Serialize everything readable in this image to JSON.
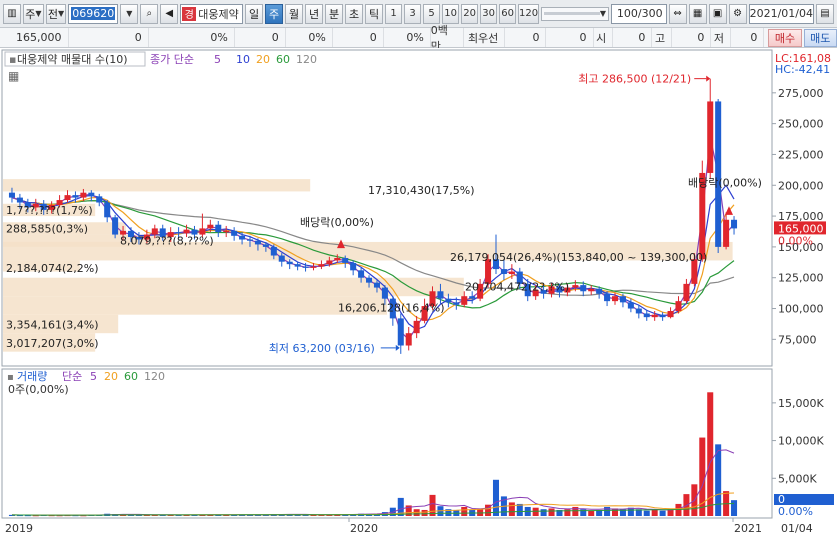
{
  "toolbar": {
    "type_label": "주",
    "prev_label": "전",
    "code": "069620",
    "name_badge": "경",
    "name": "대웅제약",
    "period_day": "일",
    "period_week": "주",
    "period_month": "월",
    "period_year": "년",
    "period_min": "분",
    "period_sec": "초",
    "period_tick": "틱",
    "intervals": [
      "1",
      "3",
      "5",
      "10",
      "20",
      "30",
      "60",
      "120"
    ],
    "bar_count": "100/300",
    "date": "2021/01/04"
  },
  "infobar": {
    "price": "165,000",
    "c2": "0",
    "c3": "0%",
    "c4": "0",
    "c5": "0%",
    "c6": "0",
    "c7": "0%",
    "c8": "0백만",
    "c9": "최우선",
    "c10": "0",
    "c11": "0",
    "c12": "시",
    "c13": "0",
    "c14": "고",
    "c15": "0",
    "c16": "저",
    "c17": "0",
    "buy": "매수",
    "sell": "매도"
  },
  "price_panel": {
    "legend_prefix": "대웅제약 매물대 수(10)",
    "ma_label": "종가 단순",
    "ma_periods": [
      "5",
      "10",
      "20",
      "60",
      "120"
    ],
    "lc_label": "LC:161,08",
    "hc_label": "HC:-42,41",
    "current_price": "165,000",
    "current_pct": "0.00%",
    "high_label": "최고 286,500 (12/21)",
    "low_label": "최저 63,200 (03/16)",
    "dividend1": "배당락(0,00%)",
    "dividend2": "배당락(0,00%)",
    "volume_profile_labels": [
      "17,310,430(17,5%)",
      "1,7??,???(1,7%)",
      "288,585(0,3%)",
      "8,079,???(8,??%)",
      "26,179,054(26,4%)(153,840,00 ~ 139,300,00)",
      "2,184,074(2,2%)",
      "20,704,472(2?,?%)",
      "16,206,128(16,4%)",
      "3,354,161(3,4%)",
      "3,017,207(3,0%)"
    ],
    "y_ticks": [
      "275,000",
      "250,000",
      "225,000",
      "200,000",
      "175,000",
      "150,000",
      "125,000",
      "100,000",
      "75,000"
    ]
  },
  "volume_panel": {
    "legend_title": "거래량",
    "ma_label": "단순",
    "ma_periods": [
      "5",
      "20",
      "60",
      "120"
    ],
    "zero_label": "0주(0,00%)",
    "current_value": "0",
    "current_pct": "0.00%",
    "y_ticks": [
      "15,000K",
      "10,000K",
      "5,000K"
    ]
  },
  "x_axis": {
    "labels": [
      "2019",
      "2020",
      "2021",
      "01/04"
    ]
  },
  "colors": {
    "up": "#e0262d",
    "down": "#1f5fd1",
    "ma5": "#8a3fb5",
    "ma10": "#2d3fd1",
    "ma20": "#f0a020",
    "ma60": "#2a9a3a",
    "ma120": "#888888",
    "profile": "#f4e1c8",
    "current_price_bg": "#e0262d"
  },
  "chart_data": {
    "type": "candlestick",
    "period": "weekly",
    "price_range": [
      55000,
      300000
    ],
    "high": 286500,
    "low": 63200,
    "candles": [
      [
        194000,
        190000,
        198000,
        186000
      ],
      [
        190000,
        186000,
        193000,
        181000
      ],
      [
        186000,
        182000,
        189000,
        178000
      ],
      [
        182000,
        185000,
        189000,
        179000
      ],
      [
        185000,
        180000,
        188000,
        176000
      ],
      [
        180000,
        184000,
        187000,
        177000
      ],
      [
        184000,
        188000,
        192000,
        182000
      ],
      [
        188000,
        192000,
        196000,
        186000
      ],
      [
        192000,
        190000,
        195000,
        186000
      ],
      [
        190000,
        194000,
        197000,
        187000
      ],
      [
        194000,
        191000,
        196000,
        187000
      ],
      [
        191000,
        186000,
        193000,
        183000
      ],
      [
        186000,
        174000,
        188000,
        170000
      ],
      [
        174000,
        160000,
        176000,
        157000
      ],
      [
        160000,
        163000,
        167000,
        155000
      ],
      [
        163000,
        158000,
        166000,
        154000
      ],
      [
        158000,
        156000,
        162000,
        152000
      ],
      [
        156000,
        160000,
        164000,
        153000
      ],
      [
        160000,
        165000,
        168000,
        157000
      ],
      [
        165000,
        158000,
        168000,
        155000
      ],
      [
        158000,
        162000,
        166000,
        154000
      ],
      [
        162000,
        161000,
        166000,
        157000
      ],
      [
        161000,
        164000,
        168000,
        158000
      ],
      [
        164000,
        160000,
        167000,
        156000
      ],
      [
        160000,
        165000,
        177000,
        158000
      ],
      [
        165000,
        168000,
        172000,
        162000
      ],
      [
        168000,
        162000,
        171000,
        158000
      ],
      [
        162000,
        163000,
        167000,
        158000
      ],
      [
        163000,
        159000,
        166000,
        155000
      ],
      [
        159000,
        156000,
        162000,
        152000
      ],
      [
        156000,
        155000,
        159000,
        150000
      ],
      [
        155000,
        152000,
        157000,
        147000
      ],
      [
        152000,
        150000,
        154000,
        146000
      ],
      [
        150000,
        143000,
        152000,
        140000
      ],
      [
        143000,
        138000,
        145000,
        134000
      ],
      [
        138000,
        136000,
        140000,
        132000
      ],
      [
        136000,
        134000,
        138000,
        131000
      ],
      [
        134000,
        133000,
        137000,
        130000
      ],
      [
        133000,
        134000,
        137000,
        131000
      ],
      [
        134000,
        136000,
        139000,
        132000
      ],
      [
        136000,
        139000,
        142000,
        134000
      ],
      [
        139000,
        141000,
        144000,
        137000
      ],
      [
        141000,
        137000,
        143000,
        133000
      ],
      [
        137000,
        131000,
        139000,
        127000
      ],
      [
        131000,
        125000,
        133000,
        121000
      ],
      [
        125000,
        121000,
        127000,
        117000
      ],
      [
        121000,
        117000,
        123000,
        113000
      ],
      [
        117000,
        108000,
        119000,
        103000
      ],
      [
        108000,
        92000,
        110000,
        86000
      ],
      [
        92000,
        70000,
        96000,
        63200
      ],
      [
        70000,
        80000,
        85000,
        66000
      ],
      [
        80000,
        90000,
        94000,
        76000
      ],
      [
        90000,
        102000,
        108000,
        88000
      ],
      [
        102000,
        114000,
        118000,
        99000
      ],
      [
        114000,
        108000,
        120000,
        104000
      ],
      [
        108000,
        105000,
        112000,
        101000
      ],
      [
        105000,
        103000,
        109000,
        99000
      ],
      [
        103000,
        110000,
        114000,
        101000
      ],
      [
        110000,
        108000,
        114000,
        104000
      ],
      [
        108000,
        120000,
        124000,
        106000
      ],
      [
        120000,
        140000,
        144000,
        117000
      ],
      [
        140000,
        132000,
        160000,
        128000
      ],
      [
        132000,
        128000,
        140000,
        123000
      ],
      [
        128000,
        130000,
        136000,
        124000
      ],
      [
        130000,
        120000,
        133000,
        116000
      ],
      [
        120000,
        110000,
        124000,
        106000
      ],
      [
        110000,
        115000,
        119000,
        107000
      ],
      [
        115000,
        112000,
        119000,
        108000
      ],
      [
        112000,
        118000,
        121000,
        109000
      ],
      [
        118000,
        113000,
        120000,
        109000
      ],
      [
        113000,
        117000,
        120000,
        110000
      ],
      [
        117000,
        119000,
        123000,
        114000
      ],
      [
        119000,
        114000,
        122000,
        110000
      ],
      [
        114000,
        116000,
        119000,
        111000
      ],
      [
        116000,
        112000,
        118000,
        108000
      ],
      [
        112000,
        106000,
        114000,
        102000
      ],
      [
        106000,
        110000,
        113000,
        103000
      ],
      [
        110000,
        105000,
        112000,
        101000
      ],
      [
        105000,
        100000,
        108000,
        97000
      ],
      [
        100000,
        96000,
        103000,
        92000
      ],
      [
        96000,
        93000,
        99000,
        90000
      ],
      [
        93000,
        95000,
        98000,
        90000
      ],
      [
        95000,
        93000,
        97000,
        90000
      ],
      [
        93000,
        98000,
        101000,
        92000
      ],
      [
        98000,
        106000,
        110000,
        96000
      ],
      [
        106000,
        120000,
        124000,
        104000
      ],
      [
        120000,
        140000,
        145000,
        118000
      ],
      [
        140000,
        210000,
        220000,
        138000
      ],
      [
        210000,
        268000,
        286500,
        205000
      ],
      [
        268000,
        150000,
        270000,
        145000
      ],
      [
        150000,
        172000,
        178000,
        148000
      ],
      [
        172000,
        165000,
        175000,
        160000
      ]
    ],
    "volume_k": [
      150,
      120,
      110,
      100,
      130,
      110,
      100,
      120,
      110,
      100,
      140,
      160,
      300,
      260,
      180,
      160,
      150,
      170,
      160,
      150,
      140,
      130,
      150,
      140,
      200,
      190,
      170,
      160,
      160,
      170,
      160,
      180,
      190,
      250,
      230,
      200,
      180,
      170,
      160,
      160,
      190,
      210,
      200,
      260,
      300,
      280,
      320,
      520,
      1100,
      2400,
      1400,
      900,
      800,
      2800,
      1300,
      900,
      800,
      1200,
      800,
      1000,
      1500,
      4800,
      2600,
      1800,
      1600,
      1200,
      1100,
      900,
      1000,
      800,
      900,
      1200,
      900,
      700,
      800,
      1200,
      1000,
      900,
      1100,
      900,
      700,
      800,
      700,
      900,
      1600,
      2900,
      4200,
      10400,
      16400,
      9500,
      3300,
      2100
    ]
  }
}
